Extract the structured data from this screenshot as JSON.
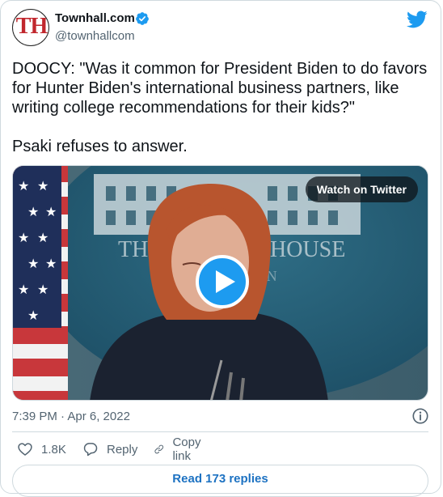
{
  "author": {
    "avatar_text": "TH",
    "display_name": "Townhall.com",
    "handle": "@townhallcom",
    "verified": true
  },
  "tweet": {
    "paragraphs": [
      "DOOCY: \"Was it common for President Biden to do favors for Hunter Biden's international business partners, like writing college recommendations for their kids?\"",
      "Psaki refuses to answer."
    ]
  },
  "media": {
    "watch_label": "Watch on Twitter",
    "backdrop_text_left": "THE",
    "backdrop_text_right": "HOUSE",
    "backdrop_text_sub": "TON"
  },
  "meta": {
    "timestamp": "7:39 PM · Apr 6, 2022"
  },
  "actions": {
    "like_count": "1.8K",
    "reply_label": "Reply",
    "copy_link_label": "Copy link"
  },
  "footer": {
    "read_replies_label": "Read 173 replies"
  },
  "colors": {
    "brand_blue": "#1d9bf0",
    "link_blue": "#1d72c2",
    "avatar_red": "#c1272d",
    "muted": "#536471",
    "border": "#cfd9de"
  },
  "icons": {
    "verified": "verified-badge-icon",
    "brand": "twitter-bird-icon",
    "play": "play-icon",
    "info": "info-icon",
    "like": "heart-icon",
    "reply": "reply-bubble-icon",
    "copy": "link-icon"
  }
}
